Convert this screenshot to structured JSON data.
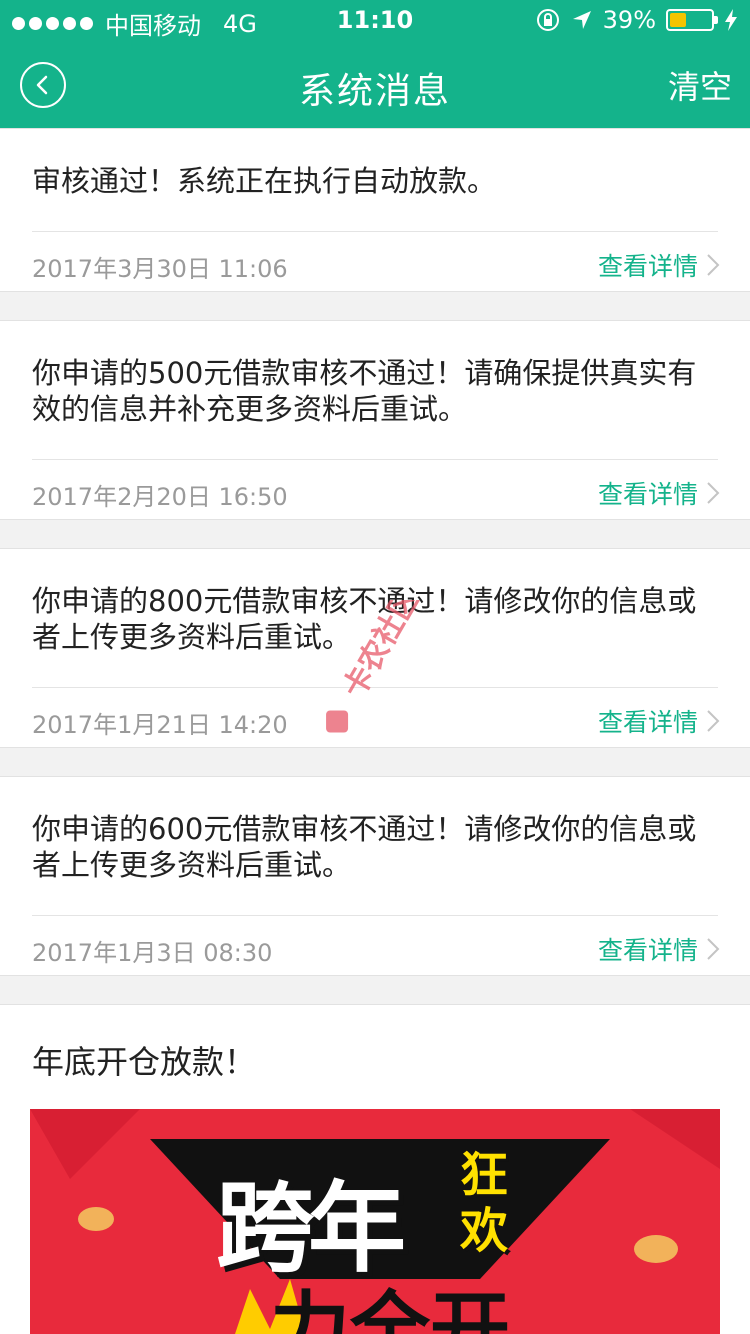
{
  "status_bar": {
    "carrier": "中国移动",
    "network": "4G",
    "time": "11:10",
    "battery": "39%",
    "battery_level": 0.39
  },
  "nav": {
    "title": "系统消息",
    "clear": "清空",
    "back_icon": "chevron-left-icon"
  },
  "messages": [
    {
      "text": "审核通过！系统正在执行自动放款。",
      "date": "2017年3月30日 11:06",
      "link": "查看详情"
    },
    {
      "text": "你申请的500元借款审核不通过！请确保提供真实有效的信息并补充更多资料后重试。",
      "date": "2017年2月20日 16:50",
      "link": "查看详情"
    },
    {
      "text": "你申请的800元借款审核不通过！请修改你的信息或者上传更多资料后重试。",
      "date": "2017年1月21日 14:20",
      "link": "查看详情"
    },
    {
      "text": "你申请的600元借款审核不通过！请修改你的信息或者上传更多资料后重试。",
      "date": "2017年1月3日 08:30",
      "link": "查看详情"
    }
  ],
  "promo": {
    "title": "年底开仓放款！",
    "banner_main": "跨年",
    "banner_side": "狂欢",
    "banner_sub": "力全开"
  },
  "watermark": "卡农社区",
  "colors": {
    "accent": "#14b38b",
    "banner": "#e82a3c",
    "banner_highlight": "#ffe100"
  }
}
